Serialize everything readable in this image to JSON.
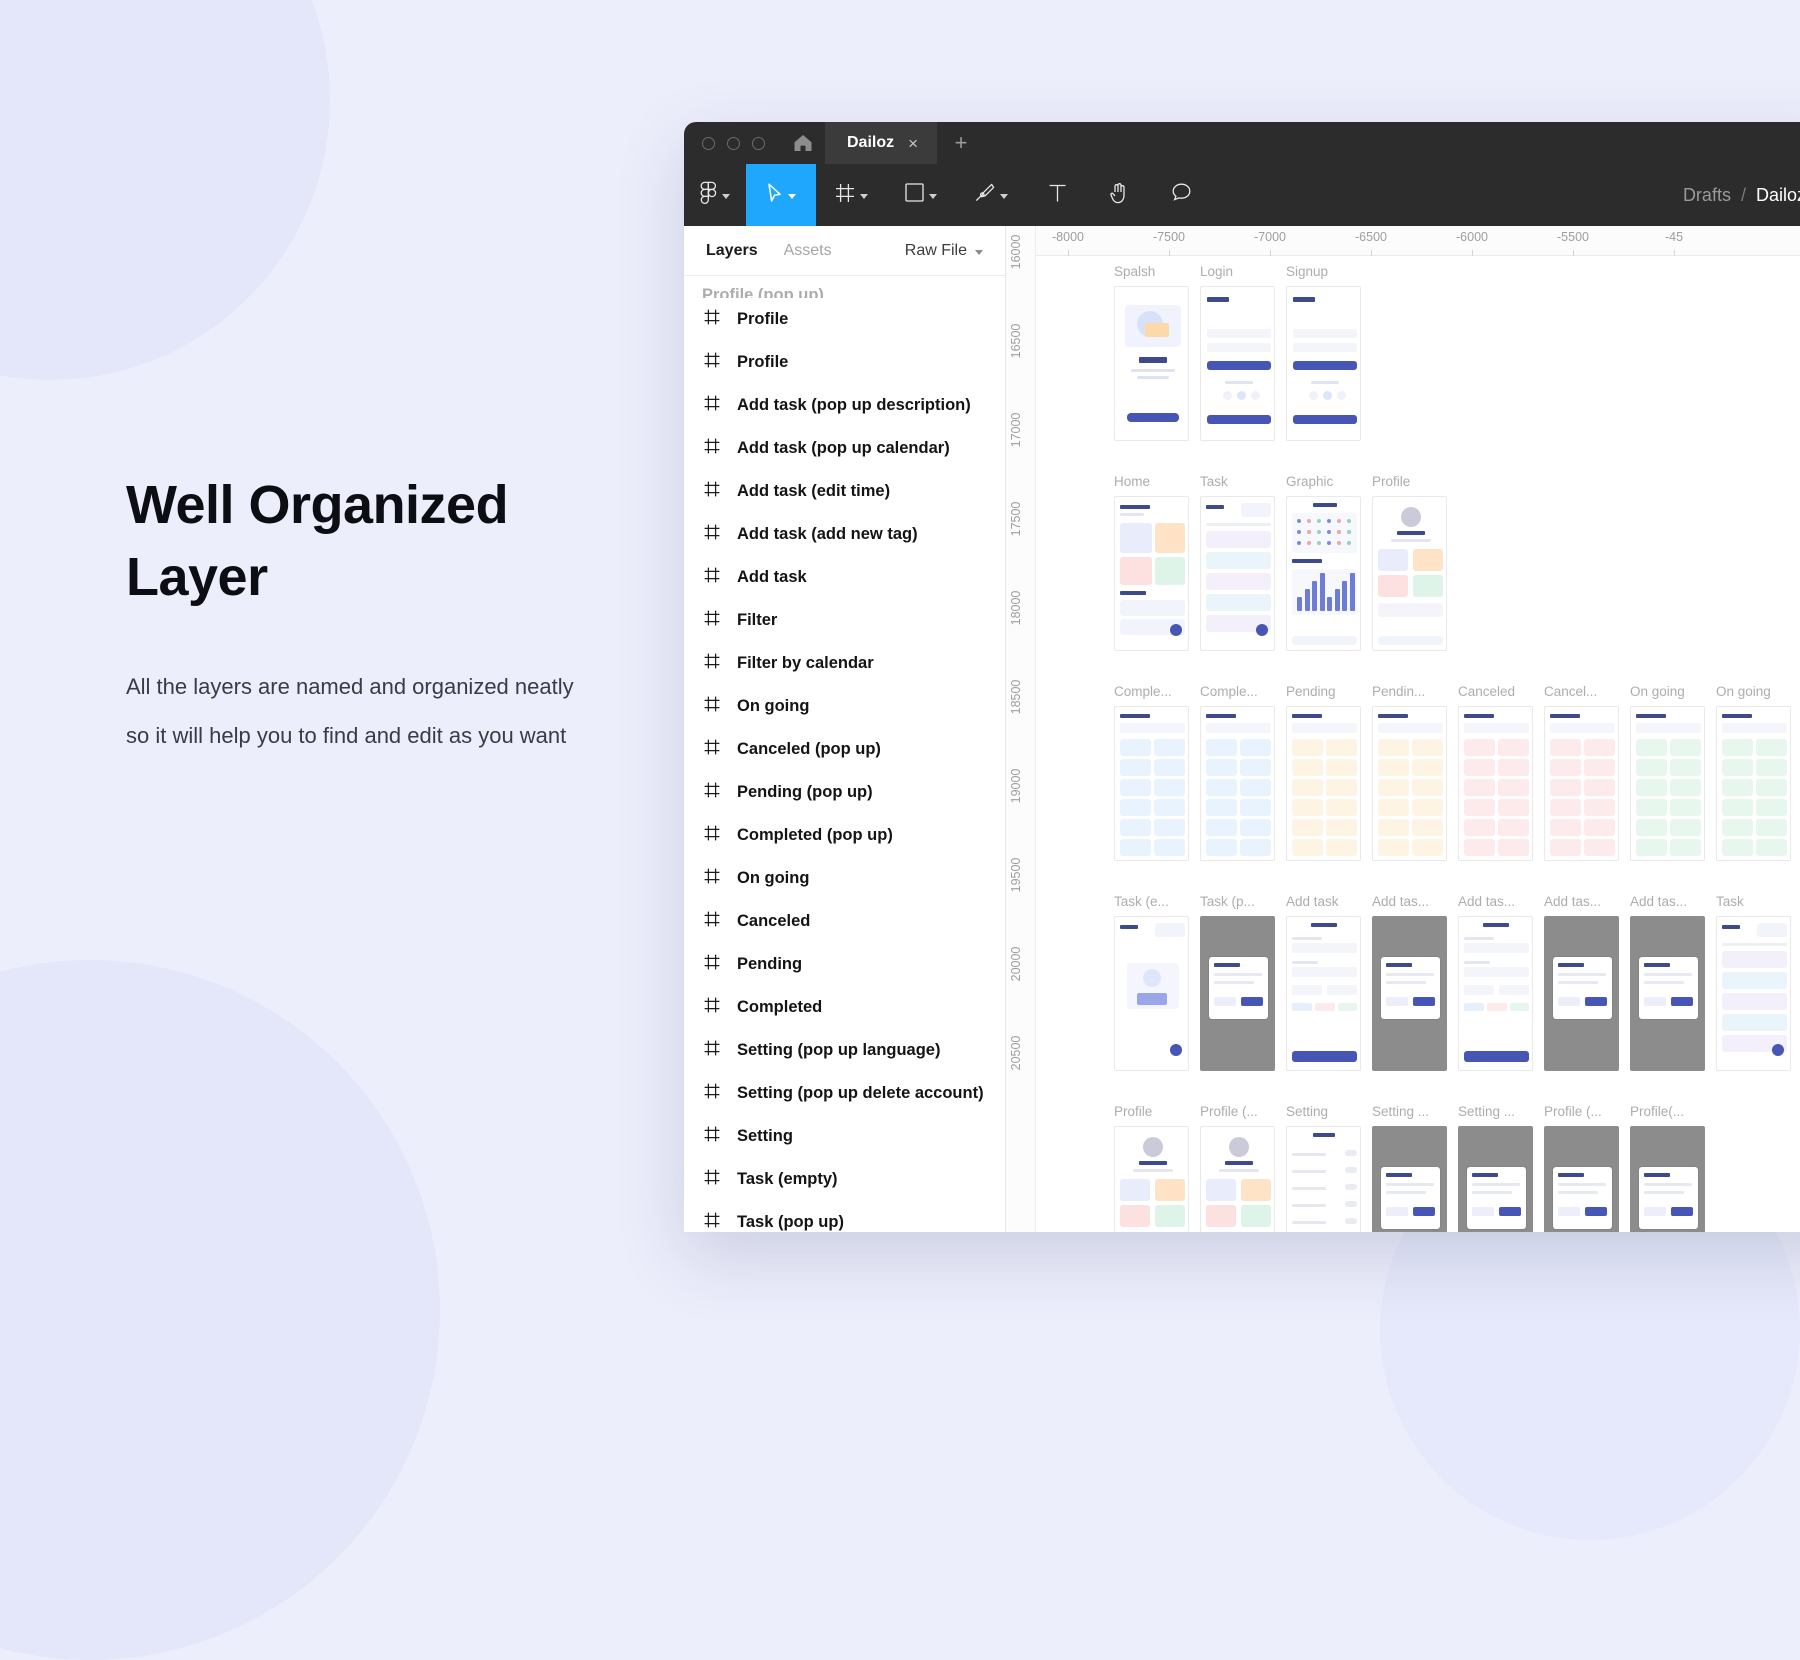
{
  "promo": {
    "title_line1": "Well Organized",
    "title_line2": "Layer",
    "body": "All the layers are named and organized neatly so it will help you to find and edit as you want"
  },
  "window": {
    "titlebar": {
      "home_icon": "home-icon",
      "tab_label": "Dailoz",
      "tab_close": "×",
      "new_tab": "+"
    },
    "toolbar": {
      "tools": [
        {
          "name": "figma-menu-tool",
          "icon": "figma-logo-icon",
          "has_caret": true,
          "active": false
        },
        {
          "name": "move-tool",
          "icon": "cursor-arrow-icon",
          "has_caret": true,
          "active": true
        },
        {
          "name": "frame-tool",
          "icon": "frame-icon",
          "has_caret": true,
          "active": false
        },
        {
          "name": "shape-tool",
          "icon": "square-icon",
          "has_caret": true,
          "active": false
        },
        {
          "name": "pen-tool",
          "icon": "pen-icon",
          "has_caret": true,
          "active": false
        },
        {
          "name": "text-tool",
          "icon": "text-t-icon",
          "has_caret": false,
          "active": false
        },
        {
          "name": "hand-tool",
          "icon": "hand-icon",
          "has_caret": false,
          "active": false
        },
        {
          "name": "comment-tool",
          "icon": "comment-bubble-icon",
          "has_caret": false,
          "active": false
        }
      ],
      "breadcrumb": {
        "project": "Drafts",
        "separator": "/",
        "file": "Dailoz",
        "caret_icon": "chevron-down-icon"
      }
    },
    "panel": {
      "tab_layers": "Layers",
      "tab_assets": "Assets",
      "raw_file": "Raw File",
      "raw_file_caret": "chevron-down-icon",
      "layers": [
        "Profile",
        "Profile",
        "Add task (pop up description)",
        "Add task (pop up calendar)",
        "Add task (edit time)",
        "Add task (add new tag)",
        "Add task",
        "Filter",
        "Filter by calendar",
        "On going",
        "Canceled (pop up)",
        "Pending (pop up)",
        "Completed (pop up)",
        "On going",
        "Canceled",
        "Pending",
        "Completed",
        "Setting (pop up language)",
        "Setting (pop up delete account)",
        "Setting",
        "Task (empty)",
        "Task (pop up)"
      ]
    },
    "canvas": {
      "ruler_h_ticks": [
        "-8000",
        "-7500",
        "-7000",
        "-6500",
        "-6000",
        "-5500",
        "-45"
      ],
      "ruler_v_ticks": [
        "16000",
        "16500",
        "17000",
        "17500",
        "18000",
        "18500",
        "19000",
        "19500",
        "20000",
        "20500"
      ],
      "frame_rows": [
        {
          "frames": [
            {
              "label": "Spalsh",
              "style": "splash"
            },
            {
              "label": "Login",
              "style": "login"
            },
            {
              "label": "Signup",
              "style": "signup"
            }
          ]
        },
        {
          "frames": [
            {
              "label": "Home",
              "style": "home"
            },
            {
              "label": "Task",
              "style": "task"
            },
            {
              "label": "Graphic",
              "style": "graphic"
            },
            {
              "label": "Profile",
              "style": "profile"
            }
          ]
        },
        {
          "frames": [
            {
              "label": "Comple...",
              "style": "list-blue"
            },
            {
              "label": "Comple...",
              "style": "list-blue"
            },
            {
              "label": "Pending",
              "style": "list-yellow"
            },
            {
              "label": "Pendin...",
              "style": "list-yellow"
            },
            {
              "label": "Canceled",
              "style": "list-red"
            },
            {
              "label": "Cancel...",
              "style": "list-red"
            },
            {
              "label": "On going",
              "style": "list-green"
            },
            {
              "label": "On going",
              "style": "list-green"
            }
          ]
        },
        {
          "frames": [
            {
              "label": "Task (e...",
              "style": "task-empty"
            },
            {
              "label": "Task (p...",
              "style": "dark-pop"
            },
            {
              "label": "Add task",
              "style": "addtask"
            },
            {
              "label": "Add tas...",
              "style": "dark-pop"
            },
            {
              "label": "Add tas...",
              "style": "addtask"
            },
            {
              "label": "Add tas...",
              "style": "dark-pop"
            },
            {
              "label": "Add tas...",
              "style": "dark-pop"
            },
            {
              "label": "Task",
              "style": "task"
            }
          ]
        },
        {
          "frames": [
            {
              "label": "Profile",
              "style": "profile"
            },
            {
              "label": "Profile (...",
              "style": "profile"
            },
            {
              "label": "Setting",
              "style": "setting"
            },
            {
              "label": "Setting ...",
              "style": "dark-pop"
            },
            {
              "label": "Setting ...",
              "style": "dark-pop"
            },
            {
              "label": "Profile (...",
              "style": "dark-pop"
            },
            {
              "label": "Profile(...",
              "style": "dark-pop"
            }
          ]
        }
      ]
    }
  },
  "colors": {
    "page_bg": "#eceefc",
    "accent_blue": "#1ea7fd",
    "chrome_dark": "#2c2c2c",
    "tab_dark": "#3b3b3b",
    "brand_purple": "#4756b5"
  }
}
